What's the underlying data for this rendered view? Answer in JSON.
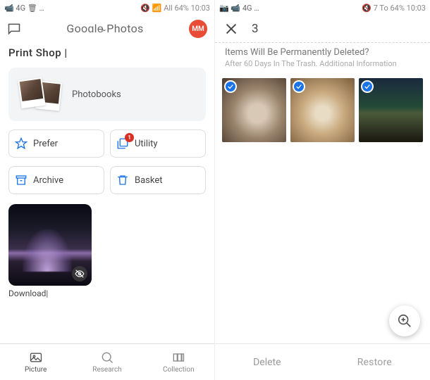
{
  "left": {
    "status": {
      "left_icons": "📹 4G 🗑 …",
      "right": "🔇 📶 All 64% 10:03"
    },
    "app_title": "Gooɑle̴ Photos",
    "avatar_initials": "MM",
    "section_title": "Print Shop |",
    "photobooks_label": "Photobooks",
    "buttons": {
      "prefer": "Prefer",
      "utility": "Utility",
      "utility_badge": "1",
      "archive": "Archive",
      "basket": "Basket"
    },
    "download_label": "Download|",
    "nav": {
      "picture": "Picture",
      "research": "Research",
      "collection": "Collection"
    }
  },
  "right": {
    "status": {
      "left_icons": "📷 📹 4G …",
      "right": "🔇 7 To 64% 10:03"
    },
    "selection_count": "3",
    "warning_title": "Items Will Be Permanently Deleted?",
    "warning_sub": "After 60 Days In The Trash. Additional Information",
    "actions": {
      "delete": "Delete",
      "restore": "Restore"
    }
  }
}
